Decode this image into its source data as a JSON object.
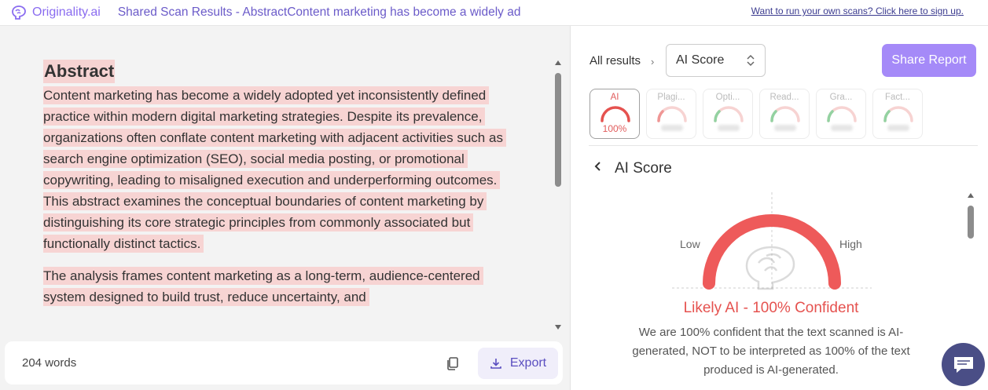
{
  "header": {
    "logo_text": "Originality.ai",
    "page_title": "Shared Scan Results - AbstractContent marketing has become a widely ad",
    "signup_link": "Want to run your own scans? Click here to sign up."
  },
  "document": {
    "heading": "Abstract",
    "paragraph1": "Content marketing has become a widely adopted yet inconsistently defined practice within modern digital marketing strategies. Despite its prevalence, organizations often conflate content marketing with adjacent activities such as search engine optimization (SEO), social media posting, or promotional copywriting, leading to misaligned execution and underperforming outcomes. This abstract examines the conceptual boundaries of content marketing by distinguishing its core strategic principles from commonly associated but functionally distinct tactics.",
    "paragraph2": "The analysis frames content marketing as a long-term, audience-centered system designed to build trust, reduce uncertainty, and"
  },
  "footer": {
    "word_count": "204 words",
    "export_label": "Export"
  },
  "results": {
    "all_results": "All results",
    "select_value": "AI Score",
    "share_label": "Share Report",
    "tabs": [
      {
        "label": "AI",
        "score": "100%"
      },
      {
        "label": "Plagi..."
      },
      {
        "label": "Opti..."
      },
      {
        "label": "Read..."
      },
      {
        "label": "Gra..."
      },
      {
        "label": "Fact..."
      }
    ],
    "section_title": "AI Score",
    "gauge_low": "Low",
    "gauge_high": "High",
    "gauge_value": 1.0,
    "result_title": "Likely AI - 100% Confident",
    "result_description": "We are 100% confident that the text scanned is AI-generated, NOT to be interpreted as 100% of the text produced is AI-generated."
  },
  "colors": {
    "accent": "#a58af8",
    "ai_red": "#e5524f",
    "highlight": "#f7d4d3",
    "chat": "#4a4e86"
  }
}
